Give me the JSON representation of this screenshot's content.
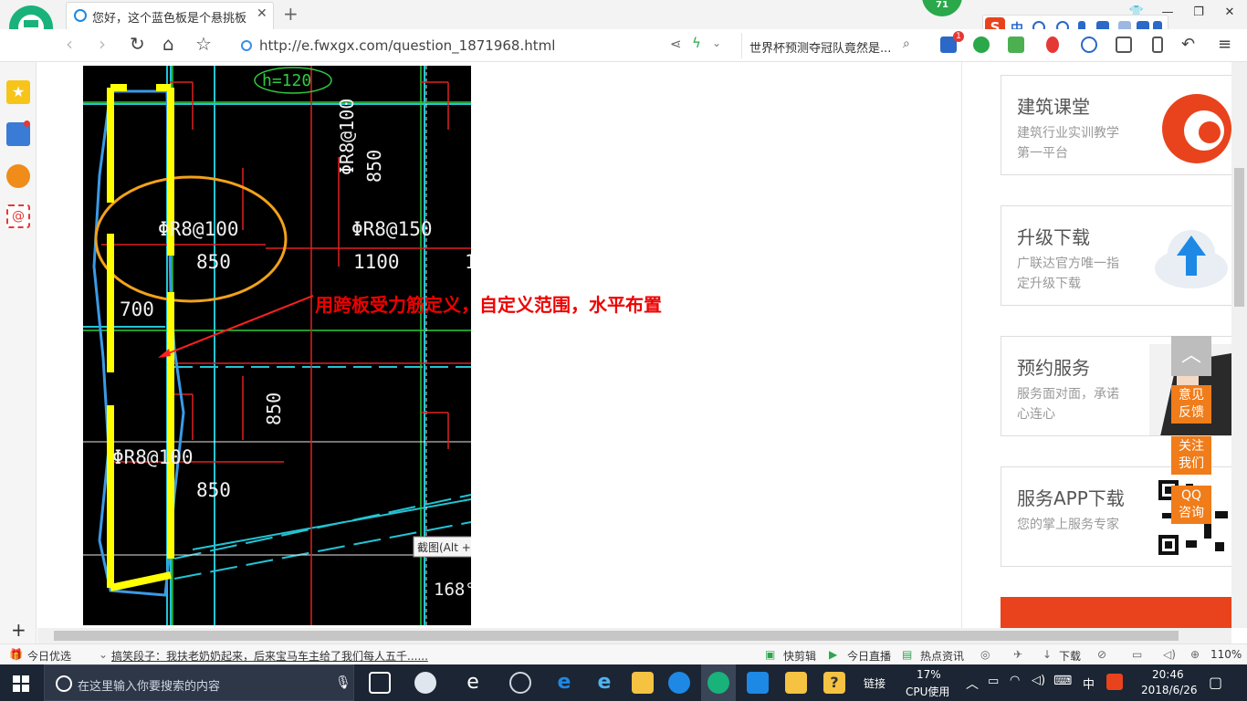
{
  "browser": {
    "tab_title": "您好，这个蓝色板是个悬挑板，跟",
    "url": "http://e.fwxgx.com/question_1871968.html",
    "search_text": "世界杯预测夺冠队竟然是...",
    "badge_count": "71",
    "toolbar_badge": "1"
  },
  "ime": {
    "logo": "S",
    "lang": "中"
  },
  "drawing": {
    "labels": [
      "h=120",
      "ΦR8@100",
      "850",
      "ΦR8@100",
      "850",
      "ΦR8@150",
      "1100",
      "1",
      "700",
      "850",
      "ΦR8@100",
      "850",
      "168°"
    ],
    "annotation": "用跨板受力筋定义，自定义范围，水平布置",
    "tooltip": "截图(Alt +"
  },
  "sidebar_cards": [
    {
      "title": "建筑课堂",
      "desc": "建筑行业实训教学第一平台"
    },
    {
      "title": "升级下载",
      "desc": "广联达官方唯一指定升级下载"
    },
    {
      "title": "预约服务",
      "desc": "服务面对面，承诺心连心"
    },
    {
      "title": "服务APP下载",
      "desc": "您的掌上服务专家"
    }
  ],
  "float_buttons": [
    "意见反馈",
    "关注我们",
    "QQ咨询"
  ],
  "statusbar": {
    "left_label": "今日优选",
    "news": "搞笑段子：我扶老奶奶起来，后来宝马车主给了我们每人五千......",
    "items": [
      "快剪辑",
      "今日直播",
      "热点资讯",
      "下载"
    ],
    "zoom": "110%"
  },
  "taskbar": {
    "search_placeholder": "在这里输入你要搜索的内容",
    "links": "链接",
    "cpu_value": "17%",
    "cpu_label": "CPU使用",
    "ime": "中",
    "time": "20:46",
    "date": "2018/6/26"
  },
  "colors": {
    "accent": "#19b27b",
    "cad_bg": "#000000",
    "annotation": "#ee0000",
    "float": "#f07c1a",
    "taskbar": "#1b2533"
  }
}
